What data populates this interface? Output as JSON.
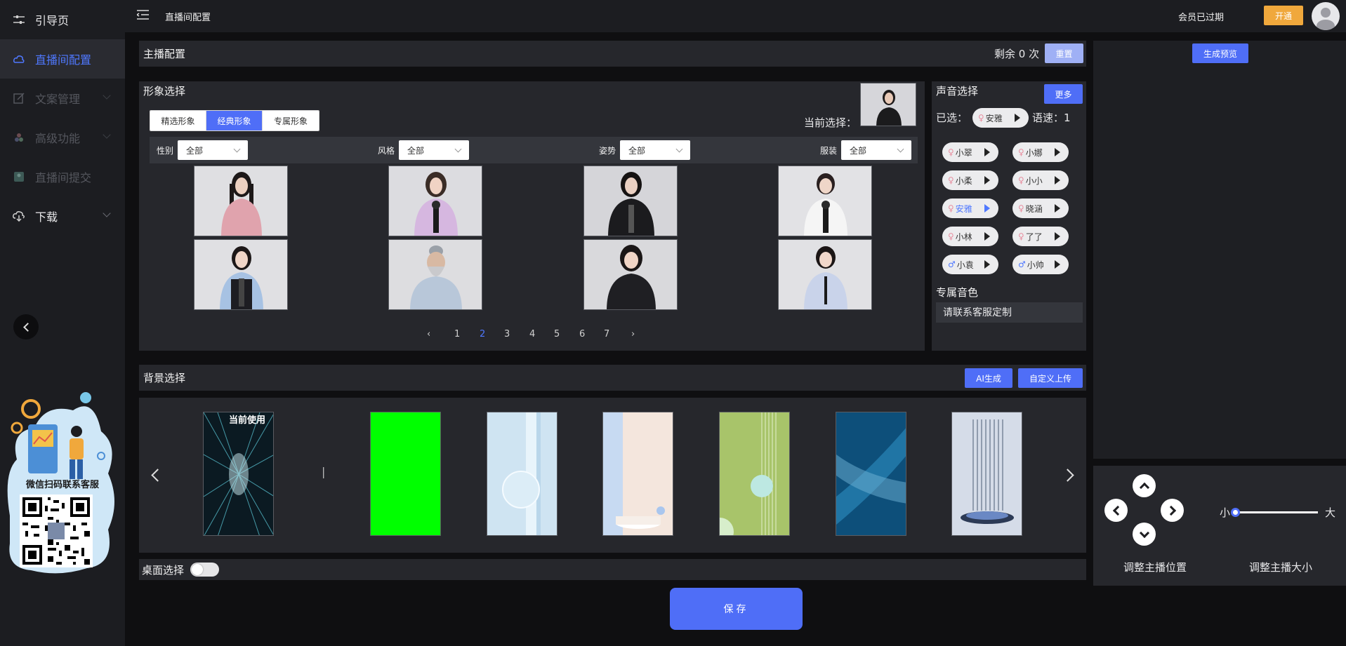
{
  "sidebar": {
    "items": [
      {
        "label": "引导页",
        "icon": "sliders-icon"
      },
      {
        "label": "直播间配置",
        "icon": "cloud-config-icon"
      },
      {
        "label": "文案管理",
        "icon": "edit-document-icon"
      },
      {
        "label": "高级功能",
        "icon": "advanced-features-icon"
      },
      {
        "label": "直播间提交",
        "icon": "submit-icon"
      },
      {
        "label": "下载",
        "icon": "cloud-download-icon"
      }
    ],
    "qr_label": "微信扫码联系客服"
  },
  "topbar": {
    "breadcrumb": "直播间配置",
    "member_status": "会员已过期",
    "open_label": "开通"
  },
  "anchor": {
    "title": "主播配置",
    "remaining": "剩余 0 次",
    "reset_label": "重置"
  },
  "image_select": {
    "title": "形象选择",
    "tabs": [
      "精选形象",
      "经典形象",
      "专属形象"
    ],
    "active_tab": "经典形象",
    "current_label": "当前选择：",
    "filters": [
      {
        "label": "性别",
        "value": "全部"
      },
      {
        "label": "风格",
        "value": "全部"
      },
      {
        "label": "姿势",
        "value": "全部"
      },
      {
        "label": "服装",
        "value": "全部"
      }
    ],
    "pages": [
      "1",
      "2",
      "3",
      "4",
      "5",
      "6",
      "7"
    ],
    "current_page": "2"
  },
  "voice": {
    "title": "声音选择",
    "more_label": "更多",
    "selected_label": "已选：",
    "selected_voice": "安雅",
    "speed_label": "语速：1",
    "voices": [
      {
        "name": "小翠",
        "gender": "♀"
      },
      {
        "name": "小娜",
        "gender": "♀"
      },
      {
        "name": "小柔",
        "gender": "♀"
      },
      {
        "name": "小小",
        "gender": "♀"
      },
      {
        "name": "安雅",
        "gender": "♀"
      },
      {
        "name": "晓涵",
        "gender": "♀"
      },
      {
        "name": "小林",
        "gender": "♀"
      },
      {
        "name": "了了",
        "gender": "♀"
      },
      {
        "name": "小袁",
        "gender": "♂"
      },
      {
        "name": "小帅",
        "gender": "♂"
      }
    ],
    "exclusive_title": "专属音色",
    "exclusive_contact": "请联系客服定制"
  },
  "background": {
    "title": "背景选择",
    "ai_label": "AI生成",
    "upload_label": "自定义上传",
    "current_tag": "当前使用",
    "cursor": "|"
  },
  "desktop": {
    "label": "桌面选择"
  },
  "preview": {
    "generate_label": "生成预览",
    "position_label": "调整主播位置",
    "size_label": "调整主播大小",
    "small": "小",
    "large": "大",
    "size_value": 0
  },
  "save_label": "保存",
  "colors": {
    "accent": "#4f6ef7",
    "warning": "#f0a83c",
    "panel": "#26272c"
  }
}
